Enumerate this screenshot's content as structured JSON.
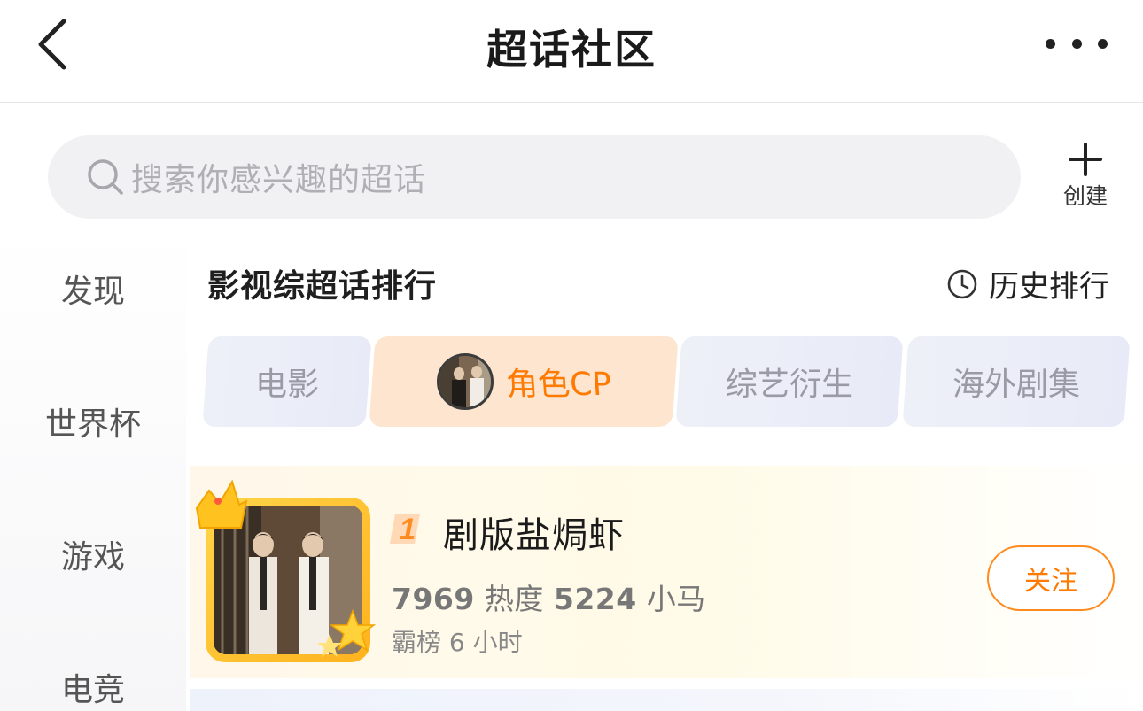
{
  "header": {
    "title": "超话社区",
    "back_icon": "chevron-left-icon",
    "more_icon": "more-horizontal-icon"
  },
  "search": {
    "placeholder": "搜索你感兴趣的超话",
    "icon": "search-icon"
  },
  "create": {
    "label": "创建",
    "icon": "plus-icon"
  },
  "sidebar": {
    "items": [
      {
        "label": "发现"
      },
      {
        "label": "世界杯"
      },
      {
        "label": "游戏"
      },
      {
        "label": "电竞"
      }
    ]
  },
  "section": {
    "title": "影视综超话排行",
    "history_label": "历史排行",
    "history_icon": "clock-icon"
  },
  "tabs": [
    {
      "label": "电影",
      "active": false
    },
    {
      "label": "角色CP",
      "active": true
    },
    {
      "label": "综艺衍生",
      "active": false
    },
    {
      "label": "海外剧集",
      "active": false
    }
  ],
  "ranking": [
    {
      "rank": "1",
      "name": "剧版盐焗虾",
      "heat_value": "7969",
      "heat_label": "热度",
      "pony_value": "5224",
      "pony_label": "小马",
      "sub": "霸榜 6 小时",
      "follow_label": "关注"
    }
  ],
  "colors": {
    "accent": "#ff7a00",
    "active_tab_bg": "#fde5cf",
    "inactive_tab_bg": "#eceef8"
  }
}
